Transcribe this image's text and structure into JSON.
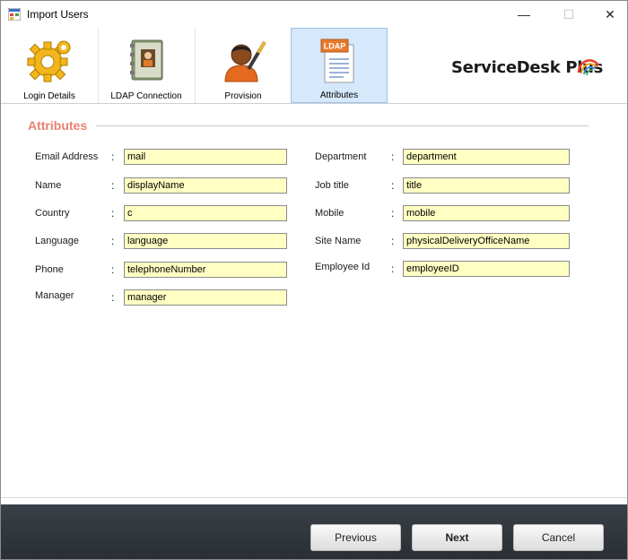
{
  "window": {
    "title": "Import Users",
    "controls": {
      "minimize": "—",
      "maximize": "☐",
      "close": "✕"
    }
  },
  "toolbar": {
    "tabs": [
      {
        "label": "Login Details",
        "icon": "gear-icon",
        "active": false
      },
      {
        "label": "LDAP Connection",
        "icon": "address-book-icon",
        "active": false
      },
      {
        "label": "Provision",
        "icon": "user-pen-icon",
        "active": false
      },
      {
        "label": "Attributes",
        "icon": "ldap-document-icon",
        "active": true
      }
    ],
    "logo_text": "ServiceDesk Plus",
    "logo_icon_text": "LDAP"
  },
  "section": {
    "title": "Attributes"
  },
  "colon": ":",
  "fields": {
    "email_address": {
      "label": "Email Address",
      "value": "mail"
    },
    "name": {
      "label": "Name",
      "value": "displayName"
    },
    "country": {
      "label": "Country",
      "value": "c"
    },
    "language": {
      "label": "Language",
      "value": "language"
    },
    "phone": {
      "label": "Phone",
      "value": "telephoneNumber"
    },
    "manager": {
      "label": "Manager",
      "value": "manager"
    },
    "department": {
      "label": "Department",
      "value": "department"
    },
    "job_title": {
      "label": "Job title",
      "value": "title"
    },
    "mobile": {
      "label": "Mobile",
      "value": "mobile"
    },
    "site_name": {
      "label": "Site Name",
      "value": "physicalDeliveryOfficeName"
    },
    "employee_id": {
      "label": "Employee Id",
      "value": "employeeID"
    }
  },
  "buttons": {
    "previous": "Previous",
    "next": "Next",
    "cancel": "Cancel"
  },
  "colors": {
    "field_bg": "#ffffc4",
    "section_title": "#e8826e",
    "active_tab": "#d6e8fb",
    "footer": "#2f343a"
  }
}
